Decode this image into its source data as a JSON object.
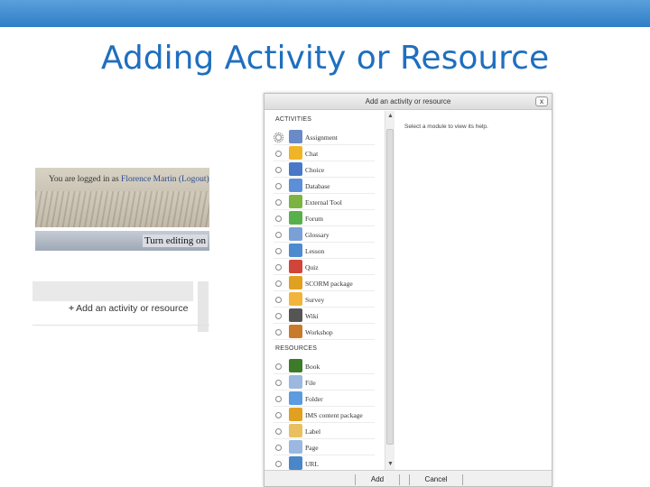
{
  "slide": {
    "title": "Adding Activity or Resource"
  },
  "course_page": {
    "login_prefix": "You are logged in as ",
    "login_user": "Florence Martin",
    "login_logout": "(Logout)",
    "editing_button": "Turn editing on",
    "add_activity_plus": "+",
    "add_activity_label": "Add an activity or resource"
  },
  "dialog": {
    "title": "Add an activity or resource",
    "close_label": "x",
    "help_text": "Select a module to view its help.",
    "activities_heading": "ACTIVITIES",
    "resources_heading": "RESOURCES",
    "activities": [
      {
        "label": "Assignment",
        "icon": "assignment-icon",
        "color": "#6a8ac8"
      },
      {
        "label": "Chat",
        "icon": "chat-icon",
        "color": "#f0b429"
      },
      {
        "label": "Choice",
        "icon": "choice-icon",
        "color": "#4a78c8"
      },
      {
        "label": "Database",
        "icon": "database-icon",
        "color": "#5b8fd6"
      },
      {
        "label": "External Tool",
        "icon": "external-tool-icon",
        "color": "#7cb342"
      },
      {
        "label": "Forum",
        "icon": "forum-icon",
        "color": "#58b04a"
      },
      {
        "label": "Glossary",
        "icon": "glossary-icon",
        "color": "#7aa0d8"
      },
      {
        "label": "Lesson",
        "icon": "lesson-icon",
        "color": "#4d8ad0"
      },
      {
        "label": "Quiz",
        "icon": "quiz-icon",
        "color": "#d0453a"
      },
      {
        "label": "SCORM package",
        "icon": "scorm-icon",
        "color": "#e0a020"
      },
      {
        "label": "Survey",
        "icon": "survey-icon",
        "color": "#f2b43a"
      },
      {
        "label": "Wiki",
        "icon": "wiki-icon",
        "color": "#555555"
      },
      {
        "label": "Workshop",
        "icon": "workshop-icon",
        "color": "#c87a2a"
      }
    ],
    "resources": [
      {
        "label": "Book",
        "icon": "book-icon",
        "color": "#3d7a2a"
      },
      {
        "label": "File",
        "icon": "file-icon",
        "color": "#9ab8e0"
      },
      {
        "label": "Folder",
        "icon": "folder-icon",
        "color": "#5b9be0"
      },
      {
        "label": "IMS content package",
        "icon": "ims-package-icon",
        "color": "#e0a020"
      },
      {
        "label": "Label",
        "icon": "label-icon",
        "color": "#e8c060"
      },
      {
        "label": "Page",
        "icon": "page-icon",
        "color": "#9ab8e0"
      },
      {
        "label": "URL",
        "icon": "url-icon",
        "color": "#4a86c8"
      }
    ],
    "add_button": "Add",
    "cancel_button": "Cancel"
  },
  "colors": {
    "title": "#1f6fbf",
    "top_bar": "#2f7ec6"
  }
}
